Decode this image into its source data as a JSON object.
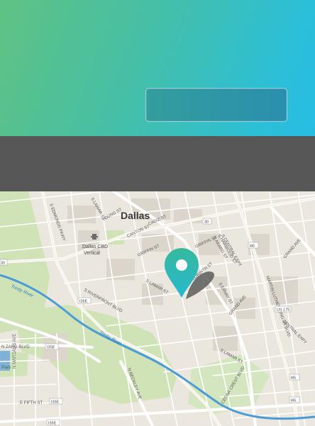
{
  "map": {
    "city_label": "Dallas",
    "poi_label_1": "Dallas CBD",
    "poi_label_2": "Vertical",
    "streets": {
      "young": "YOUNG ST",
      "canton": "CANTON ST",
      "cadiz": "CADIZ ST",
      "griffin": "GRIFFIN ST",
      "lamar_n": "S LAMAR ST",
      "lamar_mid": "S LAMAR ST",
      "lamar_s": "S LAMAR ST",
      "akard": "S AKARD ST",
      "ervay": "S ERVAY ST",
      "harwood": "S HARWOOD ST",
      "central": "S CENTRAL EXPY",
      "griffin2": "GRIFFIN ST",
      "corinth": "CORINTH ST",
      "riverfront": "S RIVERFRONT BLVD",
      "riverfront2": "RIVERFRONT BLVD",
      "grand": "GRAND AVE",
      "grand2": "GRAND AVE",
      "mlk": "MARTIN LUTHER KING JR BLVD",
      "central2": "CENTRAL EXPY",
      "cedar": "CEDAR CREST BLVD",
      "beckley": "N BECKLEY AVE",
      "marsalis": "N MARSALIS AVE",
      "fifth": "E FIFTH ST",
      "zang": "N ZANG BLVD",
      "wood": "WOOD ST",
      "trinity": "Trinity River",
      "trinity2": "Trinity River",
      "park": "Park",
      "edmonds": "S EDMONDS PKWY"
    },
    "shields": {
      "i30": "30",
      "i45a": "I45",
      "i45b": "I45",
      "i45c": "I45",
      "us175": "US 175",
      "i35e_a": "I35E",
      "i35e_b": "I35E",
      "i35e_c": "I35E",
      "i35e_d": "I35E",
      "n30": "30"
    }
  },
  "colors": {
    "accent_start": "#5fc283",
    "accent_end": "#27bde3",
    "band": "#575757",
    "marker_top": "#35b8a8",
    "marker_bottom": "#27bde3"
  }
}
